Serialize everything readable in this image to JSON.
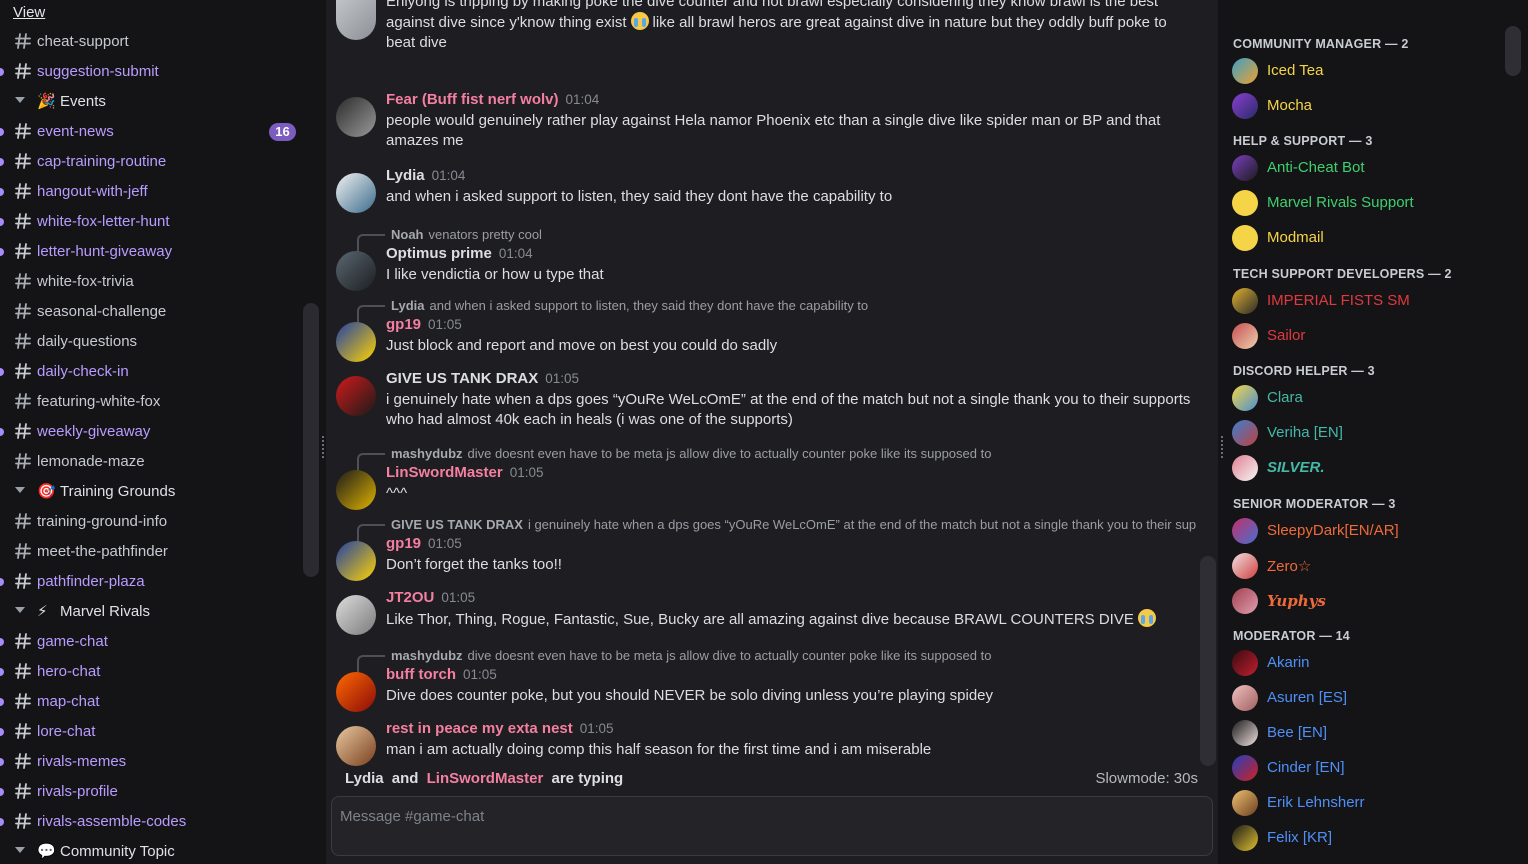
{
  "menu": {
    "view_label": "View"
  },
  "sidebar": {
    "rows": [
      {
        "type": "channel",
        "name": "cheat-support",
        "unread": false
      },
      {
        "type": "channel",
        "name": "suggestion-submit",
        "unread": true
      },
      {
        "type": "category",
        "emoji": "🎉",
        "name": "Events"
      },
      {
        "type": "channel",
        "name": "event-news",
        "unread": true,
        "badge": "16"
      },
      {
        "type": "channel",
        "name": "cap-training-routine",
        "unread": true
      },
      {
        "type": "channel",
        "name": "hangout-with-jeff",
        "unread": true
      },
      {
        "type": "channel",
        "name": "white-fox-letter-hunt",
        "unread": true
      },
      {
        "type": "channel",
        "name": "letter-hunt-giveaway",
        "unread": true
      },
      {
        "type": "channel",
        "name": "white-fox-trivia",
        "unread": false
      },
      {
        "type": "channel",
        "name": "seasonal-challenge",
        "unread": false
      },
      {
        "type": "channel",
        "name": "daily-questions",
        "unread": false
      },
      {
        "type": "channel",
        "name": "daily-check-in",
        "unread": true
      },
      {
        "type": "channel",
        "name": "featuring-white-fox",
        "unread": false
      },
      {
        "type": "channel",
        "name": "weekly-giveaway",
        "unread": true
      },
      {
        "type": "channel",
        "name": "lemonade-maze",
        "unread": false
      },
      {
        "type": "category",
        "emoji": "🎯",
        "name": "Training Grounds"
      },
      {
        "type": "channel",
        "name": "training-ground-info",
        "unread": false
      },
      {
        "type": "channel",
        "name": "meet-the-pathfinder",
        "unread": false
      },
      {
        "type": "channel",
        "name": "pathfinder-plaza",
        "unread": true
      },
      {
        "type": "category",
        "emoji": "⚡",
        "name": "Marvel Rivals"
      },
      {
        "type": "channel",
        "name": "game-chat",
        "unread": true
      },
      {
        "type": "channel",
        "name": "hero-chat",
        "unread": true
      },
      {
        "type": "channel",
        "name": "map-chat",
        "unread": true
      },
      {
        "type": "channel",
        "name": "lore-chat",
        "unread": true
      },
      {
        "type": "channel",
        "name": "rivals-memes",
        "unread": true
      },
      {
        "type": "channel",
        "name": "rivals-profile",
        "unread": true
      },
      {
        "type": "channel",
        "name": "rivals-assemble-codes",
        "unread": true
      },
      {
        "type": "category",
        "emoji": "💬",
        "name": "Community Topic"
      }
    ]
  },
  "chat": {
    "messages": [
      {
        "author": "",
        "time": "",
        "color": "#dcdee2",
        "avatar": "avatar-partial",
        "lines": [
          "Enlyong is tripping by making poke the dive counter and not brawl especially considering they know brawl is the best",
          "against dive since y'know thing exist",
          "like all brawl heros are great against dive in nature but they oddly buff poke to",
          "beat dive"
        ]
      },
      {
        "author": "Fear (Buff fist nerf wolv)",
        "time": "01:04",
        "color": "#f47fa0",
        "content": "people would genuinely rather play against Hela namor Phoenix etc than a single dive like spider man or BP and that amazes me"
      },
      {
        "author": "Lydia",
        "time": "01:04",
        "color": "#dcdee2",
        "content": "and when i asked support to listen, they said they dont have the capability to"
      },
      {
        "author": "Optimus prime",
        "time": "01:04",
        "color": "#dcdee2",
        "reply_author": "Noah",
        "reply_text": "venators pretty cool",
        "content": "I like vendictia or how u type that"
      },
      {
        "author": "gp19",
        "time": "01:05",
        "color": "#f47fa0",
        "reply_author": "Lydia",
        "reply_text": "and when i asked support to listen, they said they dont have the capability to",
        "content": "Just block and report and move on best you could do sadly"
      },
      {
        "author": "GIVE US TANK DRAX",
        "time": "01:05",
        "color": "#dcdee2",
        "content": "i genuinely hate when a dps goes “yOuRe WeLcOmE” at the end of the match but not a single thank you to their supports who had almost 40k each in heals (i was one of the supports)"
      },
      {
        "author": "LinSwordMaster",
        "time": "01:05",
        "color": "#f47fa0",
        "reply_author": "mashydubz",
        "reply_text": "dive doesnt even have to be meta js allow dive to actually counter poke like its supposed to",
        "content": "^^^"
      },
      {
        "author": "gp19",
        "time": "01:05",
        "color": "#f47fa0",
        "reply_author": "GIVE US TANK DRAX",
        "reply_text": "i genuinely hate when a dps goes “yOuRe WeLcOmE” at the end of the match but not a single thank you to their suppor...",
        "content": "Don’t forget the tanks too!!"
      },
      {
        "author": "JT2OU",
        "time": "01:05",
        "color": "#f47fa0",
        "content": "Like Thor, Thing, Rogue, Fantastic, Sue, Bucky are all amazing against dive because BRAWL COUNTERS DIVE"
      },
      {
        "author": "buff torch",
        "time": "01:05",
        "color": "#f47fa0",
        "reply_author": "mashydubz",
        "reply_text": "dive doesnt even have to be meta js allow dive to actually counter poke like its supposed to",
        "content": "Dive does counter poke, but you should NEVER be solo diving unless you’re playing spidey"
      },
      {
        "author": "rest in peace my exta nest",
        "time": "01:05",
        "color": "#f47fa0",
        "content": "man i am actually doing comp this half season for the first time and i am miserable"
      }
    ],
    "typing": {
      "name1": "Lydia",
      "and": "and",
      "name2": "LinSwordMaster",
      "suffix": "are typing"
    },
    "slowmode": "Slowmode: 30s",
    "composer_placeholder": "Message #game-chat"
  },
  "members": {
    "groups": [
      {
        "role": "COMMUNITY MANAGER — 2",
        "members": [
          {
            "name": "Iced Tea",
            "color": "#f5d547"
          },
          {
            "name": "Mocha",
            "color": "#f5d547"
          }
        ]
      },
      {
        "role": "HELP & SUPPORT — 3",
        "members": [
          {
            "name": "Anti-Cheat Bot",
            "color": "#3ecf6e"
          },
          {
            "name": "Marvel Rivals Support",
            "color": "#3ecf6e"
          },
          {
            "name": "Modmail",
            "color": "#f5d547"
          }
        ]
      },
      {
        "role": "TECH SUPPORT DEVELOPERS — 2",
        "members": [
          {
            "name": "IMPERIAL FISTS SM",
            "color": "#e0393e"
          },
          {
            "name": "Sailor",
            "color": "#e0393e"
          }
        ]
      },
      {
        "role": "DISCORD HELPER — 3",
        "members": [
          {
            "name": "Clara",
            "color": "#45b8a6"
          },
          {
            "name": "Veriha [EN]",
            "color": "#45b8a6"
          },
          {
            "name": "SILVER.",
            "color": "#45b8a6"
          }
        ]
      },
      {
        "role": "SENIOR MODERATOR — 3",
        "members": [
          {
            "name": "SleepyDark[EN/AR]",
            "color": "#ef6a3a"
          },
          {
            "name": "Zero☆",
            "color": "#ef6a3a"
          },
          {
            "name": "Yuphys",
            "color": "#ef6a3a"
          }
        ]
      },
      {
        "role": "MODERATOR — 14",
        "members": [
          {
            "name": "Akarin",
            "color": "#4f8ff7"
          },
          {
            "name": "Asuren [ES]",
            "color": "#4f8ff7"
          },
          {
            "name": "Bee [EN]",
            "color": "#4f8ff7"
          },
          {
            "name": "Cinder [EN]",
            "color": "#4f8ff7"
          },
          {
            "name": "Erik Lehnsherr",
            "color": "#4f8ff7"
          },
          {
            "name": "Felix [KR]",
            "color": "#4f8ff7"
          }
        ]
      }
    ]
  }
}
